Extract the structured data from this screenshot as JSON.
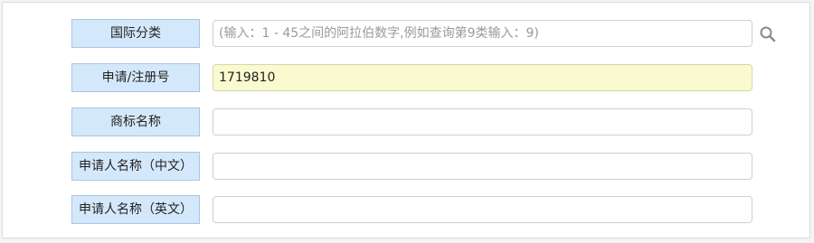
{
  "form": {
    "fields": [
      {
        "label": "国际分类",
        "placeholder": "(输入：1 - 45之间的阿拉伯数字,例如查询第9类输入：9)",
        "value": ""
      },
      {
        "label": "申请/注册号",
        "placeholder": "",
        "value": "1719810"
      },
      {
        "label": "商标名称",
        "placeholder": "",
        "value": ""
      },
      {
        "label": "申请人名称（中文）",
        "placeholder": "",
        "value": ""
      },
      {
        "label": "申请人名称（英文）",
        "placeholder": "",
        "value": ""
      }
    ],
    "search_icon": "search-icon",
    "colors": {
      "label_bg": "#d4e8fb",
      "label_border": "#a9c5e6",
      "filled_bg": "#fafad0"
    }
  }
}
